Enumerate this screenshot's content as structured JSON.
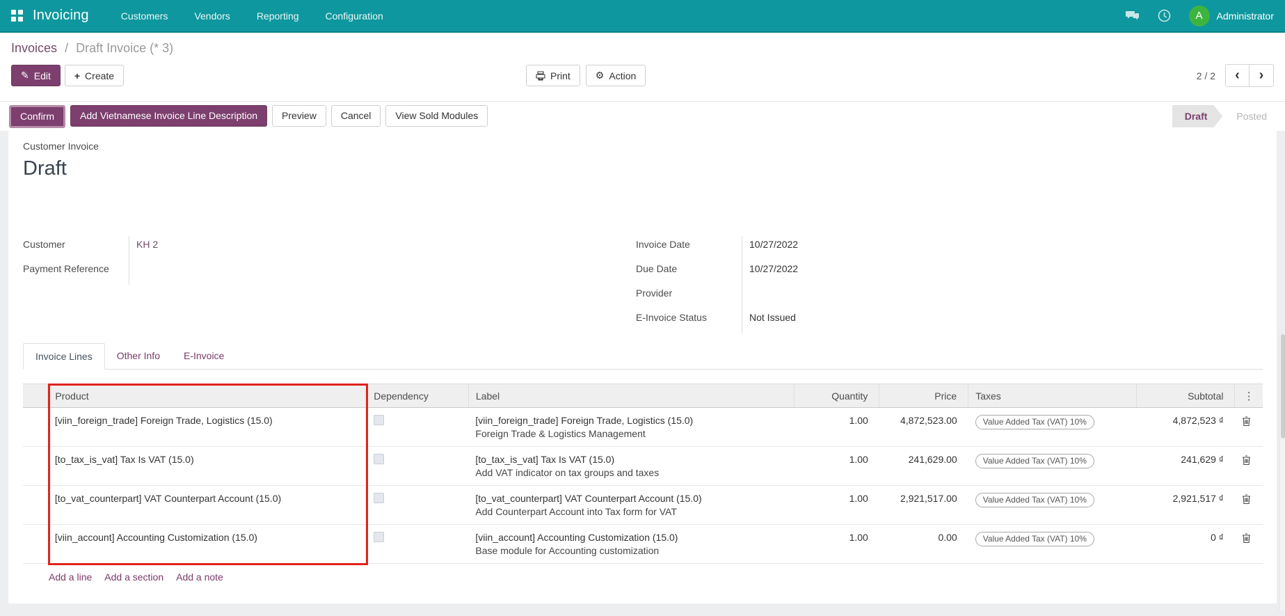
{
  "nav": {
    "app_name": "Invoicing",
    "menus": [
      "Customers",
      "Vendors",
      "Reporting",
      "Configuration"
    ],
    "user": "Administrator",
    "avatar_initial": "A"
  },
  "breadcrumb": {
    "parent": "Invoices",
    "separator": "/",
    "current": "Draft Invoice (* 3)"
  },
  "actions": {
    "edit": "Edit",
    "create": "Create",
    "print": "Print",
    "action": "Action",
    "pager_count": "2 / 2",
    "prev": "‹",
    "next": "›"
  },
  "statusbar": {
    "buttons": [
      "Confirm",
      "Add Vietnamese Invoice Line Description",
      "Preview",
      "Cancel",
      "View Sold Modules"
    ],
    "states": [
      {
        "label": "Draft",
        "active": true
      },
      {
        "label": "Posted",
        "active": false
      }
    ]
  },
  "form": {
    "type_label": "Customer Invoice",
    "title": "Draft",
    "left_fields": [
      {
        "label": "Customer",
        "value": "KH 2"
      },
      {
        "label": "Payment Reference",
        "value": ""
      }
    ],
    "right_fields": [
      {
        "label": "Invoice Date",
        "value": "10/27/2022"
      },
      {
        "label": "Due Date",
        "value": "10/27/2022"
      },
      {
        "label": "Provider",
        "value": ""
      },
      {
        "label": "E-Invoice Status",
        "value": "Not Issued"
      }
    ],
    "tabs": [
      {
        "label": "Invoice Lines",
        "active": true
      },
      {
        "label": "Other Info",
        "active": false
      },
      {
        "label": "E-Invoice",
        "active": false
      }
    ],
    "lines": {
      "columns": [
        "Product",
        "Dependency",
        "Label",
        "Quantity",
        "Price",
        "Taxes",
        "Subtotal"
      ],
      "options_icon": "⋮",
      "rows": [
        {
          "product": "[viin_foreign_trade] Foreign Trade, Logistics (15.0)",
          "dependency_checked": false,
          "label": "[viin_foreign_trade] Foreign Trade, Logistics (15.0)",
          "description": "Foreign Trade & Logistics Management",
          "quantity": "1.00",
          "price": "4,872,523.00",
          "tax": "Value Added Tax (VAT) 10%",
          "subtotal": "4,872,523 ₫"
        },
        {
          "product": "[to_tax_is_vat] Tax Is VAT (15.0)",
          "dependency_checked": false,
          "label": "[to_tax_is_vat] Tax Is VAT (15.0)",
          "description": "Add VAT indicator on tax groups and taxes",
          "quantity": "1.00",
          "price": "241,629.00",
          "tax": "Value Added Tax (VAT) 10%",
          "subtotal": "241,629 ₫"
        },
        {
          "product": "[to_vat_counterpart] VAT Counterpart Account (15.0)",
          "dependency_checked": false,
          "label": "[to_vat_counterpart] VAT Counterpart Account (15.0)",
          "description": "Add Counterpart Account into Tax form for VAT",
          "quantity": "1.00",
          "price": "2,921,517.00",
          "tax": "Value Added Tax (VAT) 10%",
          "subtotal": "2,921,517 ₫"
        },
        {
          "product": "[viin_account] Accounting Customization (15.0)",
          "dependency_checked": false,
          "label": "[viin_account] Accounting Customization (15.0)",
          "description": "Base module for Accounting customization",
          "quantity": "1.00",
          "price": "0.00",
          "tax": "Value Added Tax (VAT) 10%",
          "subtotal": "0 ₫"
        }
      ],
      "footer_links": [
        "Add a line",
        "Add a section",
        "Add a note"
      ]
    }
  },
  "colors": {
    "navbar_teal": "#0e979e",
    "primary_purple": "#7c3f6e",
    "link_purple": "#714b67",
    "avatar_green": "#3eb440",
    "annotation_red": "#df231c",
    "status_draft_text": "#7c3f6e"
  }
}
